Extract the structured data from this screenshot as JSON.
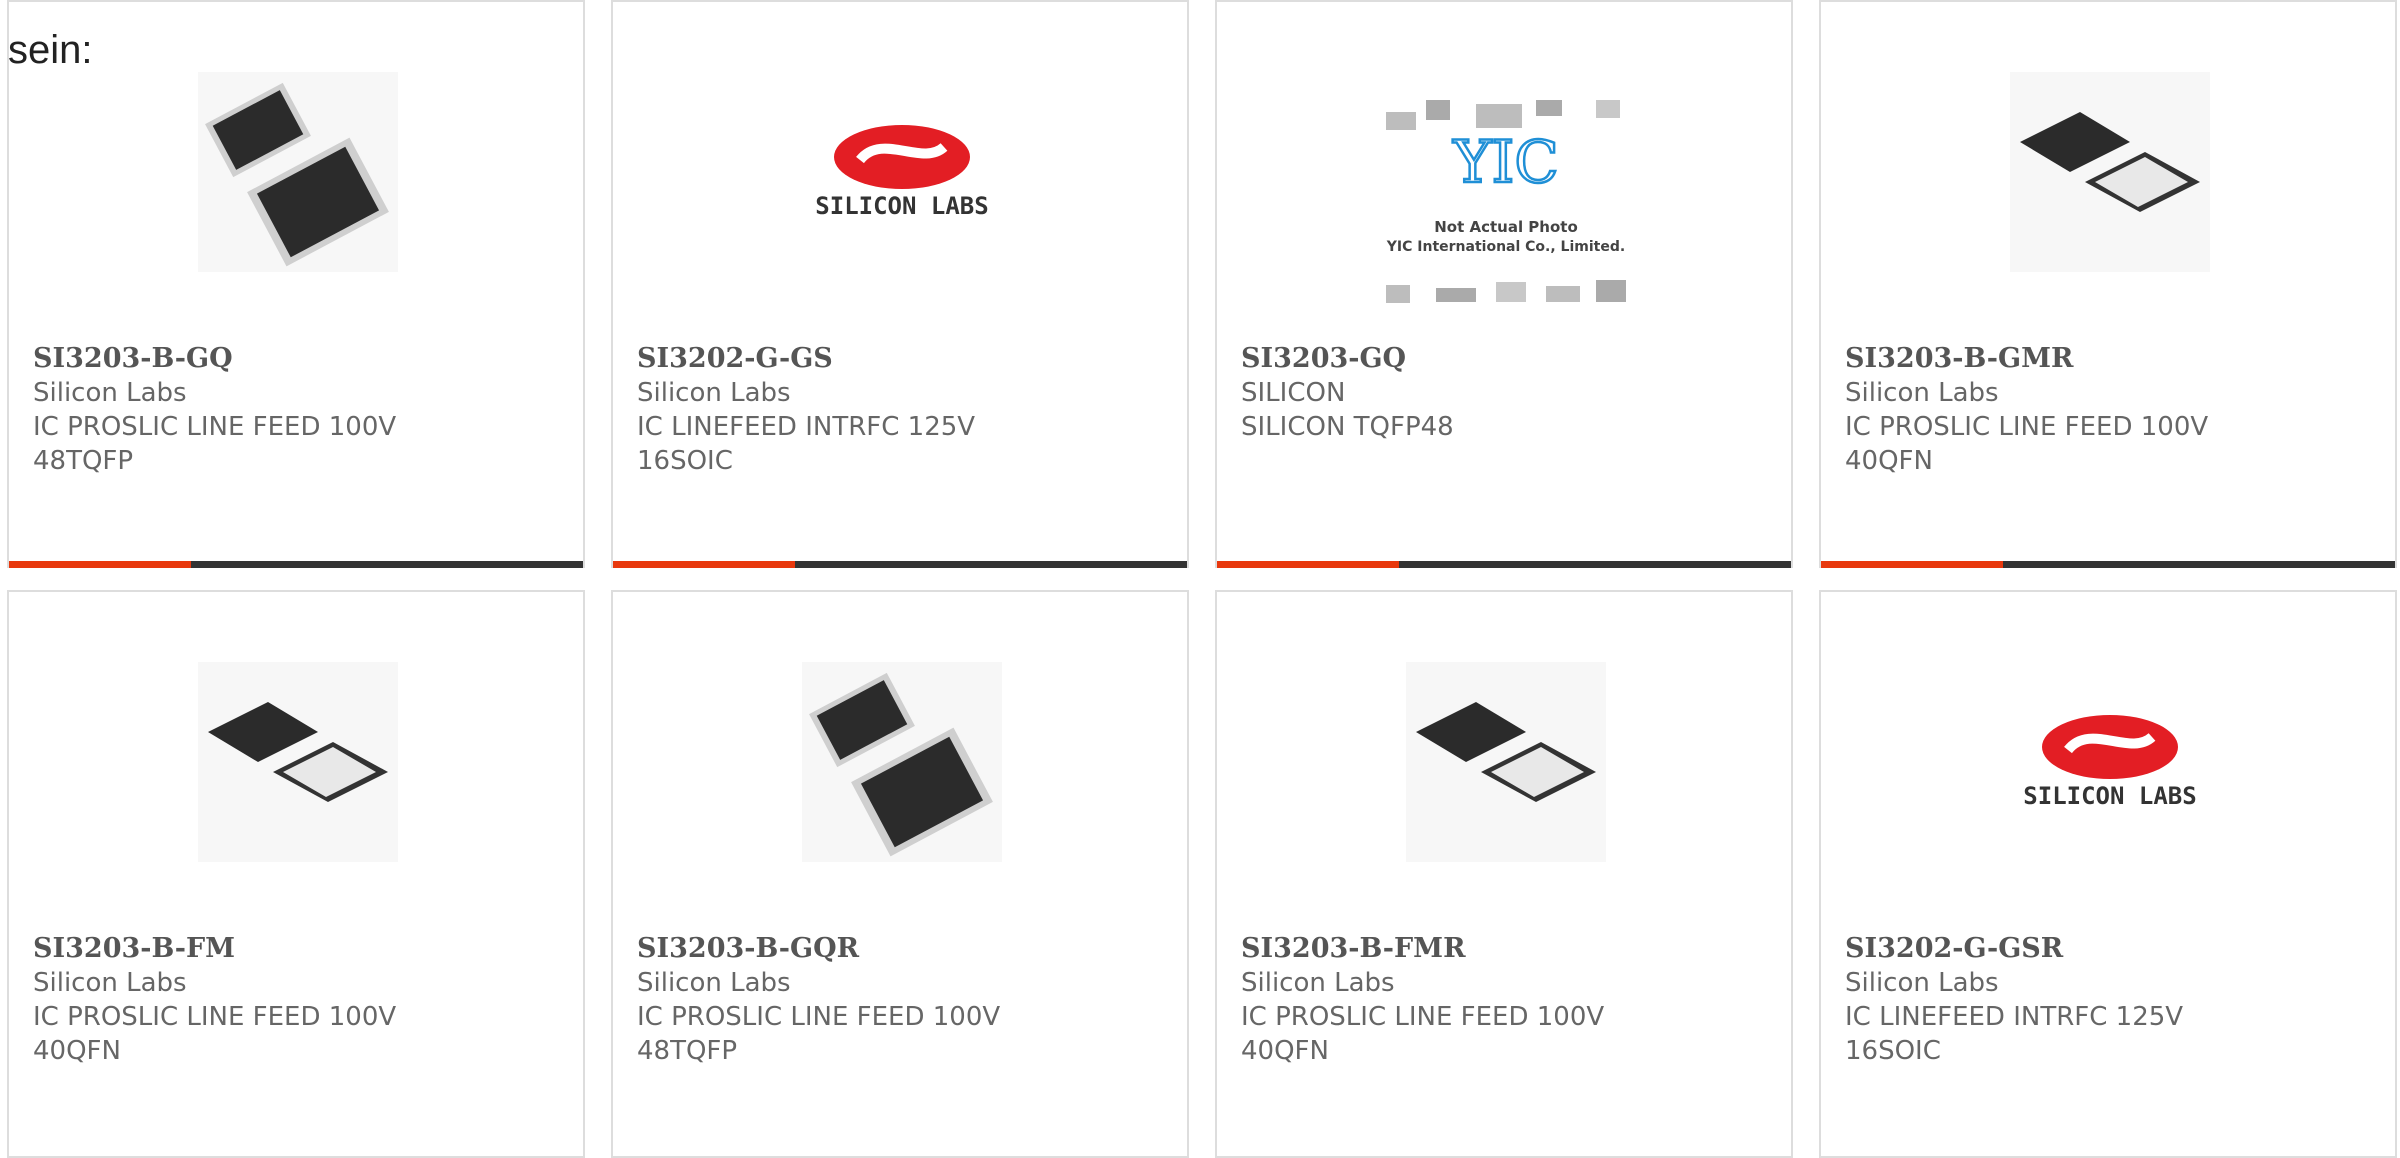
{
  "intro": "sein:",
  "accent_color": "#e8380d",
  "bar_color": "#333333",
  "products": [
    {
      "pn": "SI3203-B-GQ",
      "maker": "Silicon Labs",
      "desc": "IC PROSLIC LINE FEED 100V 48TQFP",
      "image": "tqfp-chip-image"
    },
    {
      "pn": "SI3202-G-GS",
      "maker": "Silicon Labs",
      "desc": "IC LINEFEED INTRFC 125V 16SOIC",
      "image": "silicon-labs-logo",
      "logo_text": "SILICON LABS"
    },
    {
      "pn": "SI3203-GQ",
      "maker": "SILICON",
      "desc": "SILICON TQFP48",
      "image": "yic-placeholder-image",
      "logo_text": "YIC",
      "caption1": "Not Actual Photo",
      "caption2": "YIC International Co., Limited."
    },
    {
      "pn": "SI3203-B-GMR",
      "maker": "Silicon Labs",
      "desc": "IC PROSLIC LINE FEED 100V 40QFN",
      "image": "qfn-chip-image"
    },
    {
      "pn": "SI3203-B-FM",
      "maker": "Silicon Labs",
      "desc": "IC PROSLIC LINE FEED 100V 40QFN",
      "image": "qfn-chip-image"
    },
    {
      "pn": "SI3203-B-GQR",
      "maker": "Silicon Labs",
      "desc": "IC PROSLIC LINE FEED 100V 48TQFP",
      "image": "tqfp-chip-image"
    },
    {
      "pn": "SI3203-B-FMR",
      "maker": "Silicon Labs",
      "desc": "IC PROSLIC LINE FEED 100V 40QFN",
      "image": "qfn-chip-image"
    },
    {
      "pn": "SI3202-G-GSR",
      "maker": "Silicon Labs",
      "desc": "IC LINEFEED INTRFC 125V 16SOIC",
      "image": "silicon-labs-logo",
      "logo_text": "SILICON LABS"
    }
  ]
}
